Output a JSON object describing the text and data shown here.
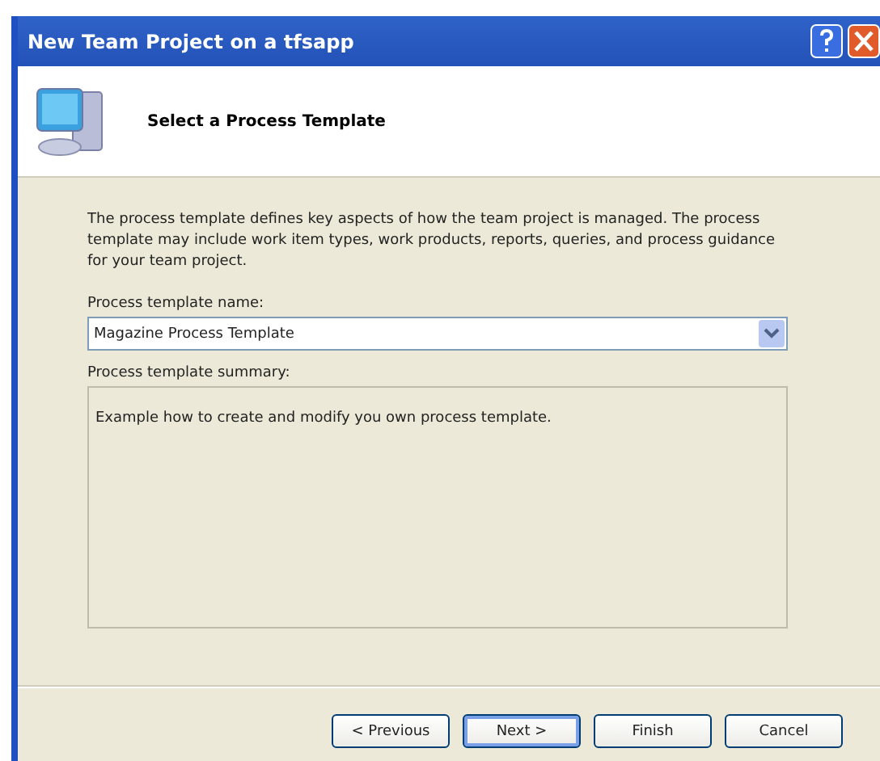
{
  "window": {
    "title": "New Team Project on a tfsapp"
  },
  "header": {
    "title": "Select a Process Template"
  },
  "description": "The process template defines key aspects of how the team project is managed. The process template may include work item types, work products, reports, queries, and process guidance for your team project.",
  "template_name": {
    "label": "Process template name:",
    "value": "Magazine Process Template"
  },
  "summary": {
    "label": "Process template summary:",
    "text": "Example how to create and modify you own process template."
  },
  "buttons": [
    {
      "label": "< Previous",
      "default": false
    },
    {
      "label": "Next >",
      "default": true
    },
    {
      "label": "Finish",
      "default": false
    },
    {
      "label": "Cancel",
      "default": false
    }
  ]
}
